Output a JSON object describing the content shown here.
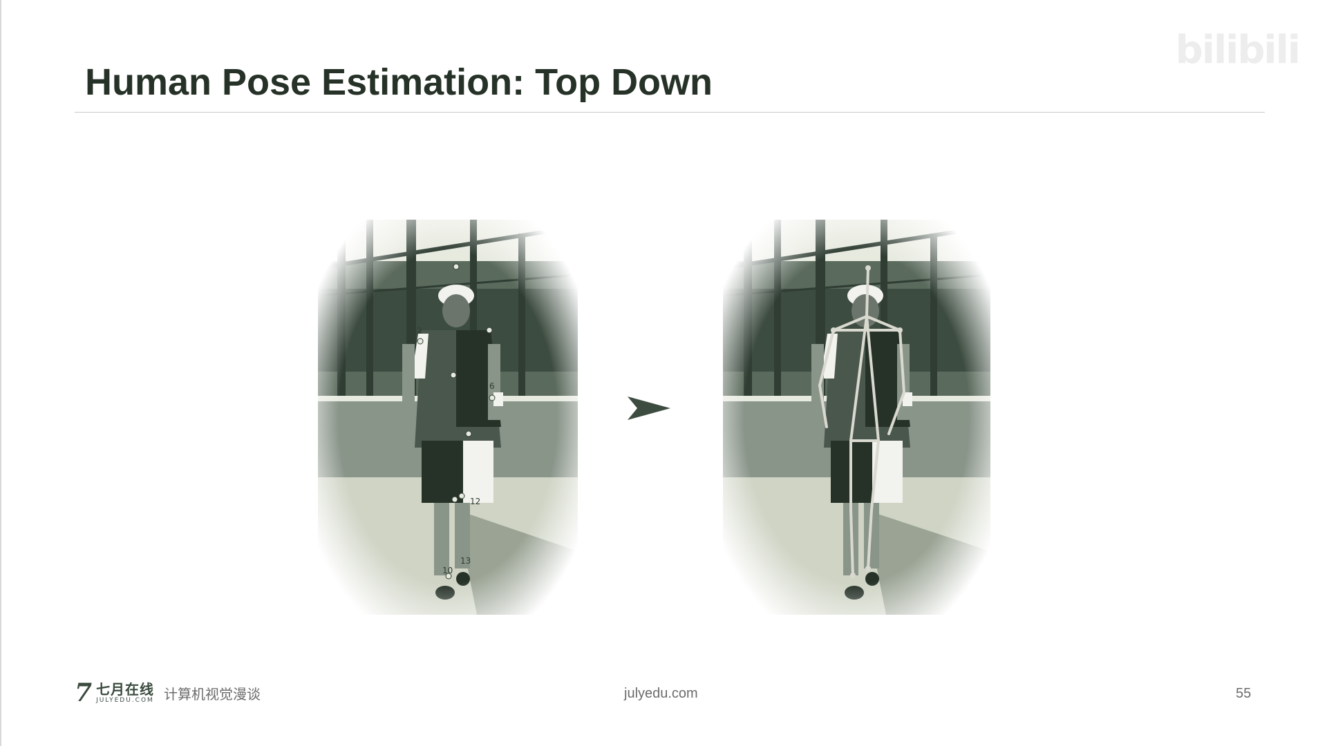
{
  "slide": {
    "title": "Human Pose Estimation: Top Down",
    "footer": {
      "logo_mark": "7",
      "logo_cn": "七月在线",
      "logo_en": "JULYEDU.COM",
      "subtitle": "计算机视觉漫谈",
      "url": "julyedu.com",
      "page_number": "55"
    },
    "watermark": "bilibili",
    "left_image": {
      "description_icon": "tennis-player-photo-with-keypoints",
      "keypoint_labels": [
        "2",
        "6",
        "12",
        "13",
        "10"
      ]
    },
    "right_image": {
      "description_icon": "tennis-player-photo-with-skeleton"
    },
    "arrow_icon": "chevron-right-icon"
  },
  "colors": {
    "title": "#263228",
    "photo_dark": "#2f3d33",
    "photo_mid": "#8a958a",
    "photo_light": "#e7eadf",
    "skeleton": "#d9d9d0"
  }
}
